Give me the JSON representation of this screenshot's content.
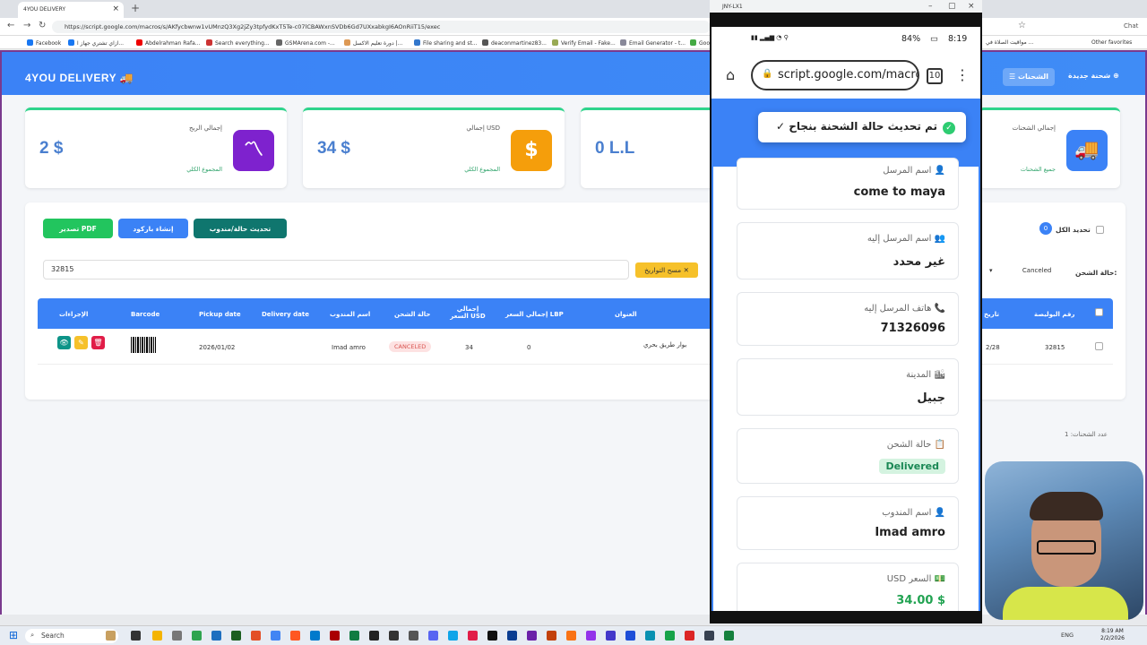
{
  "browser": {
    "tab_title": "4YOU DELIVERY",
    "url": "https://script.google.com/macros/s/AKfycbwnw1vUMnzQ3Xg2jZy3tpfydKxT5Te-c07lCBAWxnSVDb6Gd7UXxabkgI6AOnRiiT15/exec",
    "bookmarks": [
      "Facebook",
      "ازاي تشتري جهاز ا...",
      "Abdelrahman Rafa...",
      "Search everything...",
      "GSMArena.com -...",
      "دورة تعليم الاكسل |...",
      "File sharing and st...",
      "deaconmartinez83...",
      "Verify Email - Fake...",
      "Email Generator - t...",
      "Goo"
    ],
    "right_bookmarks": [
      "مواقيت الصلاة في ...",
      "Other favorites"
    ],
    "chat_label": "Chat"
  },
  "app": {
    "logo": "4YOU DELIVERY",
    "new_shipment": "شحنة جديدة",
    "shipments": "الشحنات"
  },
  "cards": [
    {
      "label": "إجمالي الربح",
      "value": "2 $",
      "sub": "المجموع الكلي",
      "color": "#7e22ce"
    },
    {
      "label": "إجمالي USD",
      "value": "34 $",
      "sub": "المجموع الكلي",
      "color": "#f59e0b"
    },
    {
      "value": "0 L.L"
    },
    {
      "label": "إجمالي الشحنات",
      "sub": "جميع الشحنات",
      "color": "#3b82f6"
    }
  ],
  "toolbar": {
    "export_pdf": "تصدير PDF",
    "create_barcode": "إنشاء باركود",
    "update_status": "تحديث حالة/مندوب",
    "select_all": "تحديد الكل",
    "selected_count": "0",
    "search_value": "32815",
    "clear_dates": "مسح التواريخ",
    "status_label": "حالة الشحن:",
    "status_value": "Canceled"
  },
  "table": {
    "headers": [
      "رقم البوليصة",
      "تاريخ",
      "العنوان",
      "إجمالي السعر LBP",
      "إجمالي السعر USD",
      "حالة الشحن",
      "اسم المندوب",
      "Delivery date",
      "Pickup date",
      "Barcode",
      "الإجراءات"
    ],
    "row": {
      "waybill": "32815",
      "date": "2/28",
      "address": "بوار طريق بحري",
      "lbp": "0",
      "usd": "34",
      "status": "CANCELED",
      "agent": "Imad amro",
      "delivery_date": "",
      "pickup_date": "2026/01/02"
    },
    "count_text": "عدد الشحنات: 1"
  },
  "phone": {
    "window_title": "JNY-LX1",
    "time": "8:19",
    "battery": "84%",
    "url": "script.google.com/macro",
    "tabs_count": "10",
    "toast": "تم تحديث حالة الشحنة بنجاح ✓",
    "fields": [
      {
        "label": "اسم المرسل",
        "value": "come to maya"
      },
      {
        "label": "اسم المرسل إليه",
        "value": "غير محدد"
      },
      {
        "label": "هاتف المرسل إليه",
        "value": "71326096"
      },
      {
        "label": "المدينة",
        "value": "جبيل"
      },
      {
        "label": "حالة الشحن",
        "value": "Delivered"
      },
      {
        "label": "اسم المندوب",
        "value": "Imad amro"
      },
      {
        "label": "السعر USD",
        "value": "$ 34.00"
      }
    ]
  },
  "taskbar": {
    "search": "Search",
    "lang": "ENG",
    "time": "8:19 AM",
    "date": "2/2/2026"
  }
}
